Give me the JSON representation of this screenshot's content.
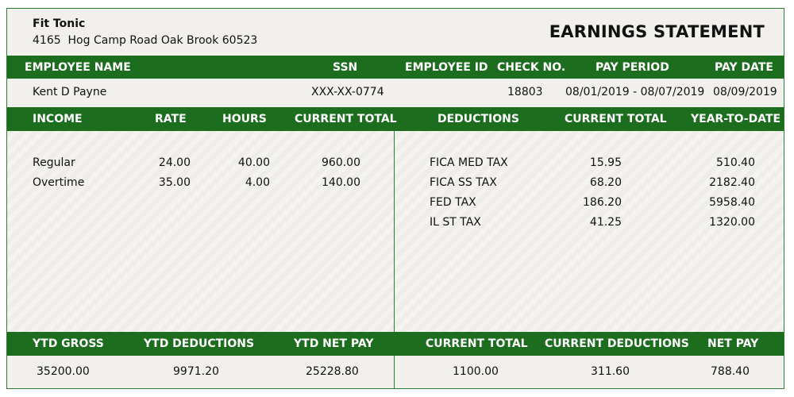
{
  "company": {
    "name": "Fit Tonic",
    "address": "4165  Hog Camp Road Oak Brook 60523"
  },
  "title": "EARNINGS STATEMENT",
  "employee_header": {
    "name": "EMPLOYEE NAME",
    "ssn": "SSN",
    "employee_id": "EMPLOYEE ID",
    "check_no": "CHECK NO.",
    "pay_period": "PAY PERIOD",
    "pay_date": "PAY DATE"
  },
  "employee": {
    "name": "Kent D Payne",
    "ssn": "XXX-XX-0774",
    "employee_id": "",
    "check_no": "18803",
    "pay_period": "08/01/2019 - 08/07/2019",
    "pay_date": "08/09/2019"
  },
  "income_header": {
    "income": "INCOME",
    "rate": "RATE",
    "hours": "HOURS",
    "current_total": "CURRENT TOTAL"
  },
  "deductions_header": {
    "deductions": "DEDUCTIONS",
    "current_total": "CURRENT TOTAL",
    "ytd": "YEAR-TO-DATE"
  },
  "income": [
    {
      "label": "Regular",
      "rate": "24.00",
      "hours": "40.00",
      "total": "960.00"
    },
    {
      "label": "Overtime",
      "rate": "35.00",
      "hours": "4.00",
      "total": "140.00"
    }
  ],
  "deductions": [
    {
      "label": "FICA  MED TAX",
      "current": "15.95",
      "ytd": "510.40"
    },
    {
      "label": "FICA  SS TAX",
      "current": "68.20",
      "ytd": "2182.40"
    },
    {
      "label": "FED TAX",
      "current": "186.20",
      "ytd": "5958.40"
    },
    {
      "label": "IL  ST TAX",
      "current": "41.25",
      "ytd": "1320.00"
    }
  ],
  "totals_header": {
    "ytd_gross": "YTD GROSS",
    "ytd_deductions": "YTD DEDUCTIONS",
    "ytd_net_pay": "YTD NET PAY",
    "current_total": "CURRENT TOTAL",
    "current_deductions": "CURRENT DEDUCTIONS",
    "net_pay": "NET PAY"
  },
  "totals": {
    "ytd_gross": "35200.00",
    "ytd_deductions": "9971.20",
    "ytd_net_pay": "25228.80",
    "current_total": "1100.00",
    "current_deductions": "311.60",
    "net_pay": "788.40"
  },
  "colors": {
    "accent": "#1d6d1f",
    "background": "#f1f0ec",
    "text": "#111111"
  }
}
